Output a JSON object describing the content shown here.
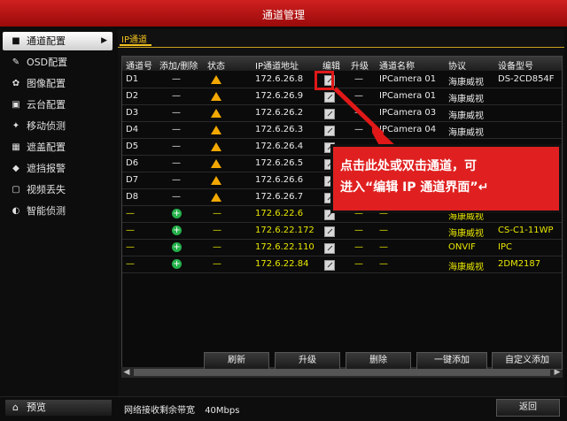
{
  "window": {
    "title": "通道管理"
  },
  "sidebar": {
    "items": [
      {
        "label": "通道配置",
        "icon": "camera-icon",
        "active": true
      },
      {
        "label": "OSD配置",
        "icon": "edit-icon"
      },
      {
        "label": "图像配置",
        "icon": "gear-icon"
      },
      {
        "label": "云台配置",
        "icon": "ptz-icon"
      },
      {
        "label": "移动侦测",
        "icon": "motion-icon"
      },
      {
        "label": "遮盖配置",
        "icon": "mask-icon"
      },
      {
        "label": "遮挡报警",
        "icon": "alarm-icon"
      },
      {
        "label": "视频丢失",
        "icon": "video-loss-icon"
      },
      {
        "label": "智能侦测",
        "icon": "smart-icon"
      }
    ]
  },
  "tabs": {
    "active": "IP通道"
  },
  "table": {
    "headers": [
      "通道号",
      "添加/删除",
      "状态",
      "IP通道地址",
      "编辑",
      "升级",
      "通道名称",
      "协议",
      "设备型号"
    ],
    "rows": [
      {
        "ch": "D1",
        "add": "—",
        "status": "warn",
        "ip": "172.6.26.8",
        "edit": "icon",
        "upg": "—",
        "name": "IPCamera 01",
        "proto": "海康威视",
        "model": "DS-2CD854F",
        "yellow": false
      },
      {
        "ch": "D2",
        "add": "—",
        "status": "warn",
        "ip": "172.6.26.9",
        "edit": "icon",
        "upg": "—",
        "name": "IPCamera 01",
        "proto": "海康威视",
        "model": "",
        "yellow": false
      },
      {
        "ch": "D3",
        "add": "—",
        "status": "warn",
        "ip": "172.6.26.2",
        "edit": "icon",
        "upg": "—",
        "name": "IPCamera 03",
        "proto": "海康威视",
        "model": "",
        "yellow": false
      },
      {
        "ch": "D4",
        "add": "—",
        "status": "warn",
        "ip": "172.6.26.3",
        "edit": "icon",
        "upg": "—",
        "name": "IPCamera 04",
        "proto": "海康威视",
        "model": "",
        "yellow": false
      },
      {
        "ch": "D5",
        "add": "—",
        "status": "warn",
        "ip": "172.6.26.4",
        "edit": "icon",
        "upg": "—",
        "name": "",
        "proto": "",
        "model": "",
        "yellow": false
      },
      {
        "ch": "D6",
        "add": "—",
        "status": "warn",
        "ip": "172.6.26.5",
        "edit": "icon",
        "upg": "—",
        "name": "",
        "proto": "",
        "model": "",
        "yellow": false
      },
      {
        "ch": "D7",
        "add": "—",
        "status": "warn",
        "ip": "172.6.26.6",
        "edit": "icon",
        "upg": "—",
        "name": "",
        "proto": "",
        "model": "",
        "yellow": false
      },
      {
        "ch": "D8",
        "add": "—",
        "status": "warn",
        "ip": "172.6.26.7",
        "edit": "icon",
        "upg": "—",
        "name": "",
        "proto": "",
        "model": "",
        "yellow": false
      },
      {
        "ch": "—",
        "add": "plus",
        "status": "—",
        "ip": "172.6.22.6",
        "edit": "icon",
        "upg": "—",
        "name": "—",
        "proto": "海康威视",
        "model": "",
        "yellow": true
      },
      {
        "ch": "—",
        "add": "plus",
        "status": "—",
        "ip": "172.6.22.172",
        "edit": "icon",
        "upg": "—",
        "name": "—",
        "proto": "海康威视",
        "model": "CS-C1-11WP",
        "yellow": true
      },
      {
        "ch": "—",
        "add": "plus",
        "status": "—",
        "ip": "172.6.22.110",
        "edit": "icon",
        "upg": "—",
        "name": "—",
        "proto": "ONVIF",
        "model": "IPC",
        "yellow": true
      },
      {
        "ch": "—",
        "add": "plus",
        "status": "—",
        "ip": "172.6.22.84",
        "edit": "icon",
        "upg": "—",
        "name": "—",
        "proto": "海康威视",
        "model": "2DM2187",
        "yellow": true
      }
    ]
  },
  "buttons": {
    "refresh": "刷新",
    "upgrade": "升级",
    "delete": "删除",
    "one_click_add": "一键添加",
    "custom_add": "自定义添加"
  },
  "footer": {
    "preview": "预览",
    "bandwidth_label": "网络接收剩余带宽",
    "bandwidth_value": "40Mbps",
    "return": "返回"
  },
  "callout": {
    "line1": "点击此处或双击通道，可",
    "line2": "进入“编辑 IP 通道界面”↵"
  },
  "colors": {
    "titlebar": "#c01515",
    "warning": "#f2a800",
    "add": "#25b14a",
    "callout": "#e02020",
    "yellow_text": "#e8e600"
  }
}
